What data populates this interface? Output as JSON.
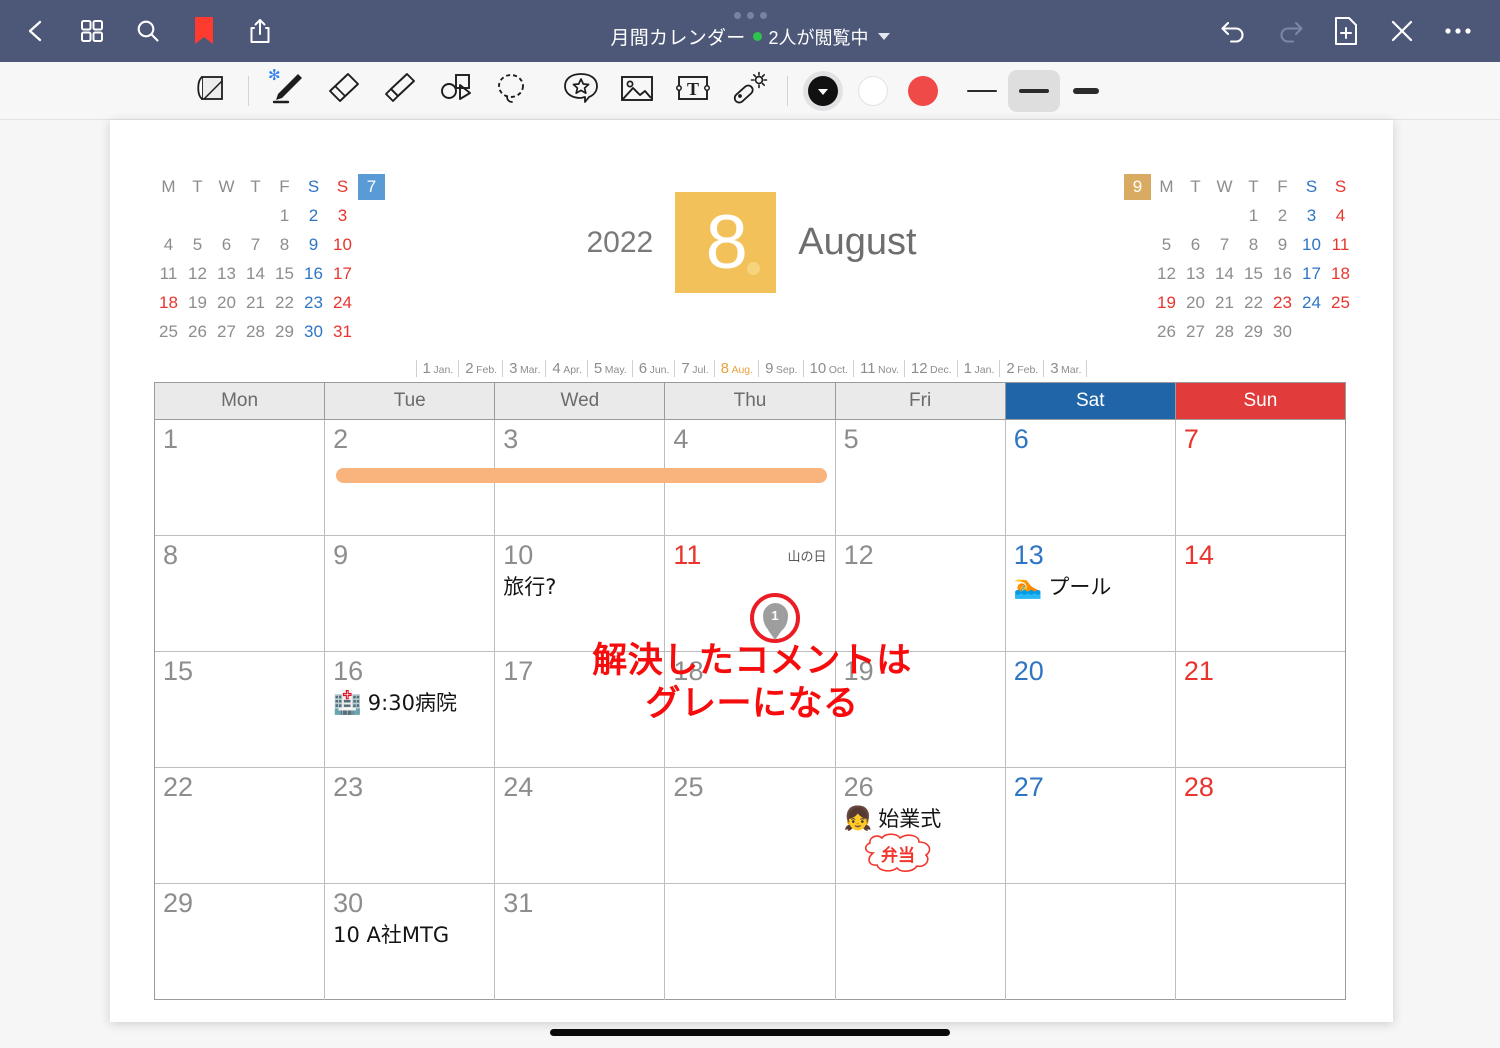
{
  "navbar": {
    "back_icon": "chevron-left-icon",
    "grid_icon": "grid-icon",
    "search_icon": "search-icon",
    "bookmark_icon": "bookmark-icon",
    "share_icon": "share-icon",
    "title": "月間カレンダー",
    "presence": "2人が閲覧中",
    "undo_icon": "undo-icon",
    "redo_icon": "redo-icon",
    "add_page_icon": "add-page-icon",
    "close_icon": "close-icon",
    "more_icon": "more-icon",
    "bg_color": "#4d5878",
    "presence_color": "#2fc24d"
  },
  "toolbar": {
    "tools": [
      {
        "name": "page-flip-tool",
        "label": "ページめくり",
        "active": false
      },
      {
        "name": "pen-tool",
        "label": "ペン",
        "active": true,
        "bluetooth": true
      },
      {
        "name": "eraser-tool",
        "label": "消しゴム",
        "active": false
      },
      {
        "name": "highlighter-tool",
        "label": "蛍光ペン",
        "active": false
      },
      {
        "name": "shape-tool",
        "label": "図形",
        "active": false
      },
      {
        "name": "lasso-tool",
        "label": "投げ縄",
        "active": false
      },
      {
        "name": "sticker-tool",
        "label": "ステッカー",
        "active": false
      },
      {
        "name": "image-tool",
        "label": "画像",
        "active": false
      },
      {
        "name": "text-tool",
        "label": "テキスト",
        "active": false
      },
      {
        "name": "magic-tool",
        "label": "マジック",
        "active": false
      }
    ],
    "colors": [
      {
        "name": "color-black",
        "hex": "#111111",
        "selected": true
      },
      {
        "name": "color-white",
        "hex": "#ffffff",
        "selected": false
      },
      {
        "name": "color-red",
        "hex": "#ef4a48",
        "selected": false
      }
    ],
    "strokes": [
      {
        "name": "stroke-thin",
        "width": 2,
        "selected": false
      },
      {
        "name": "stroke-medium",
        "width": 4,
        "selected": true
      },
      {
        "name": "stroke-thick",
        "width": 6,
        "selected": false
      }
    ]
  },
  "page": {
    "header": {
      "year": "2022",
      "month_number": "8",
      "month_name": "August",
      "accent_color": "#f3c15a"
    },
    "mini_prev": {
      "badge": "7",
      "badge_color": "#5a9bd5",
      "badge_side": "right",
      "weekdays": [
        "M",
        "T",
        "W",
        "T",
        "F",
        "S",
        "S"
      ],
      "weeks": [
        [
          "",
          "",
          "",
          "",
          "1",
          "2",
          "3"
        ],
        [
          "4",
          "5",
          "6",
          "7",
          "8",
          "9",
          "10"
        ],
        [
          "11",
          "12",
          "13",
          "14",
          "15",
          "16",
          "17"
        ],
        [
          "18",
          "19",
          "20",
          "21",
          "22",
          "23",
          "24"
        ],
        [
          "25",
          "26",
          "27",
          "28",
          "29",
          "30",
          "31"
        ]
      ],
      "holidays": [
        "18"
      ]
    },
    "mini_next": {
      "badge": "9",
      "badge_color": "#d9ab62",
      "badge_side": "left",
      "weekdays": [
        "M",
        "T",
        "W",
        "T",
        "F",
        "S",
        "S"
      ],
      "weeks": [
        [
          "",
          "",
          "",
          "1",
          "2",
          "3",
          "4"
        ],
        [
          "5",
          "6",
          "7",
          "8",
          "9",
          "10",
          "11"
        ],
        [
          "12",
          "13",
          "14",
          "15",
          "16",
          "17",
          "18"
        ],
        [
          "19",
          "20",
          "21",
          "22",
          "23",
          "24",
          "25"
        ],
        [
          "26",
          "27",
          "28",
          "29",
          "30",
          "",
          ""
        ]
      ],
      "holidays": [
        "19",
        "23"
      ]
    },
    "month_strip": [
      {
        "n": "1",
        "a": "Jan.",
        "current": false
      },
      {
        "n": "2",
        "a": "Feb.",
        "current": false
      },
      {
        "n": "3",
        "a": "Mar.",
        "current": false
      },
      {
        "n": "4",
        "a": "Apr.",
        "current": false
      },
      {
        "n": "5",
        "a": "May.",
        "current": false
      },
      {
        "n": "6",
        "a": "Jun.",
        "current": false
      },
      {
        "n": "7",
        "a": "Jul.",
        "current": false
      },
      {
        "n": "8",
        "a": "Aug.",
        "current": true
      },
      {
        "n": "9",
        "a": "Sep.",
        "current": false
      },
      {
        "n": "10",
        "a": "Oct.",
        "current": false
      },
      {
        "n": "11",
        "a": "Nov.",
        "current": false
      },
      {
        "n": "12",
        "a": "Dec.",
        "current": false
      },
      {
        "n": "1",
        "a": "Jan.",
        "current": false
      },
      {
        "n": "2",
        "a": "Feb.",
        "current": false
      },
      {
        "n": "3",
        "a": "Mar.",
        "current": false
      }
    ],
    "weekday_headers": [
      {
        "label": "Mon",
        "kind": "weekday"
      },
      {
        "label": "Tue",
        "kind": "weekday"
      },
      {
        "label": "Wed",
        "kind": "weekday"
      },
      {
        "label": "Thu",
        "kind": "weekday"
      },
      {
        "label": "Fri",
        "kind": "weekday"
      },
      {
        "label": "Sat",
        "kind": "sat"
      },
      {
        "label": "Sun",
        "kind": "sun"
      }
    ],
    "header_colors": {
      "sat": "#1f65a8",
      "sun": "#e13b3b",
      "weekday_bg": "#eaeaea"
    },
    "weeks": [
      [
        {
          "day": "1",
          "kind": "weekday"
        },
        {
          "day": "2",
          "kind": "weekday"
        },
        {
          "day": "3",
          "kind": "weekday"
        },
        {
          "day": "4",
          "kind": "weekday"
        },
        {
          "day": "5",
          "kind": "weekday"
        },
        {
          "day": "6",
          "kind": "sat"
        },
        {
          "day": "7",
          "kind": "sun"
        }
      ],
      [
        {
          "day": "8",
          "kind": "weekday"
        },
        {
          "day": "9",
          "kind": "weekday"
        },
        {
          "day": "10",
          "kind": "weekday",
          "note": "旅行?"
        },
        {
          "day": "11",
          "kind": "holiday",
          "holiday_label": "山の日"
        },
        {
          "day": "12",
          "kind": "weekday"
        },
        {
          "day": "13",
          "kind": "sat",
          "emoji": "🏊",
          "note": "プール"
        },
        {
          "day": "14",
          "kind": "sun"
        }
      ],
      [
        {
          "day": "15",
          "kind": "weekday"
        },
        {
          "day": "16",
          "kind": "weekday",
          "emoji": "🏥",
          "note": "9:30病院"
        },
        {
          "day": "17",
          "kind": "weekday"
        },
        {
          "day": "18",
          "kind": "weekday"
        },
        {
          "day": "19",
          "kind": "weekday"
        },
        {
          "day": "20",
          "kind": "sat"
        },
        {
          "day": "21",
          "kind": "sun"
        }
      ],
      [
        {
          "day": "22",
          "kind": "weekday"
        },
        {
          "day": "23",
          "kind": "weekday"
        },
        {
          "day": "24",
          "kind": "weekday"
        },
        {
          "day": "25",
          "kind": "weekday"
        },
        {
          "day": "26",
          "kind": "weekday",
          "emoji": "👧",
          "note": "始業式"
        },
        {
          "day": "27",
          "kind": "sat"
        },
        {
          "day": "28",
          "kind": "sun"
        }
      ],
      [
        {
          "day": "29",
          "kind": "weekday"
        },
        {
          "day": "30",
          "kind": "weekday",
          "note": "10 A社MTG"
        },
        {
          "day": "31",
          "kind": "weekday"
        },
        {
          "day": "",
          "kind": "weekday"
        },
        {
          "day": "",
          "kind": "weekday"
        },
        {
          "day": "",
          "kind": "sat"
        },
        {
          "day": "",
          "kind": "sun"
        }
      ]
    ],
    "annotations": {
      "highlight_color": "#f9b37d",
      "comment_pin_number": "1",
      "comment_pin_ring_color": "#ec1c24",
      "comment_pin_fill_color": "#9e9e9e",
      "red_note_line1": "解決したコメントは",
      "red_note_line2": "グレーになる",
      "red_note_color": "#f60c0c",
      "bento_text": "弁当"
    }
  }
}
